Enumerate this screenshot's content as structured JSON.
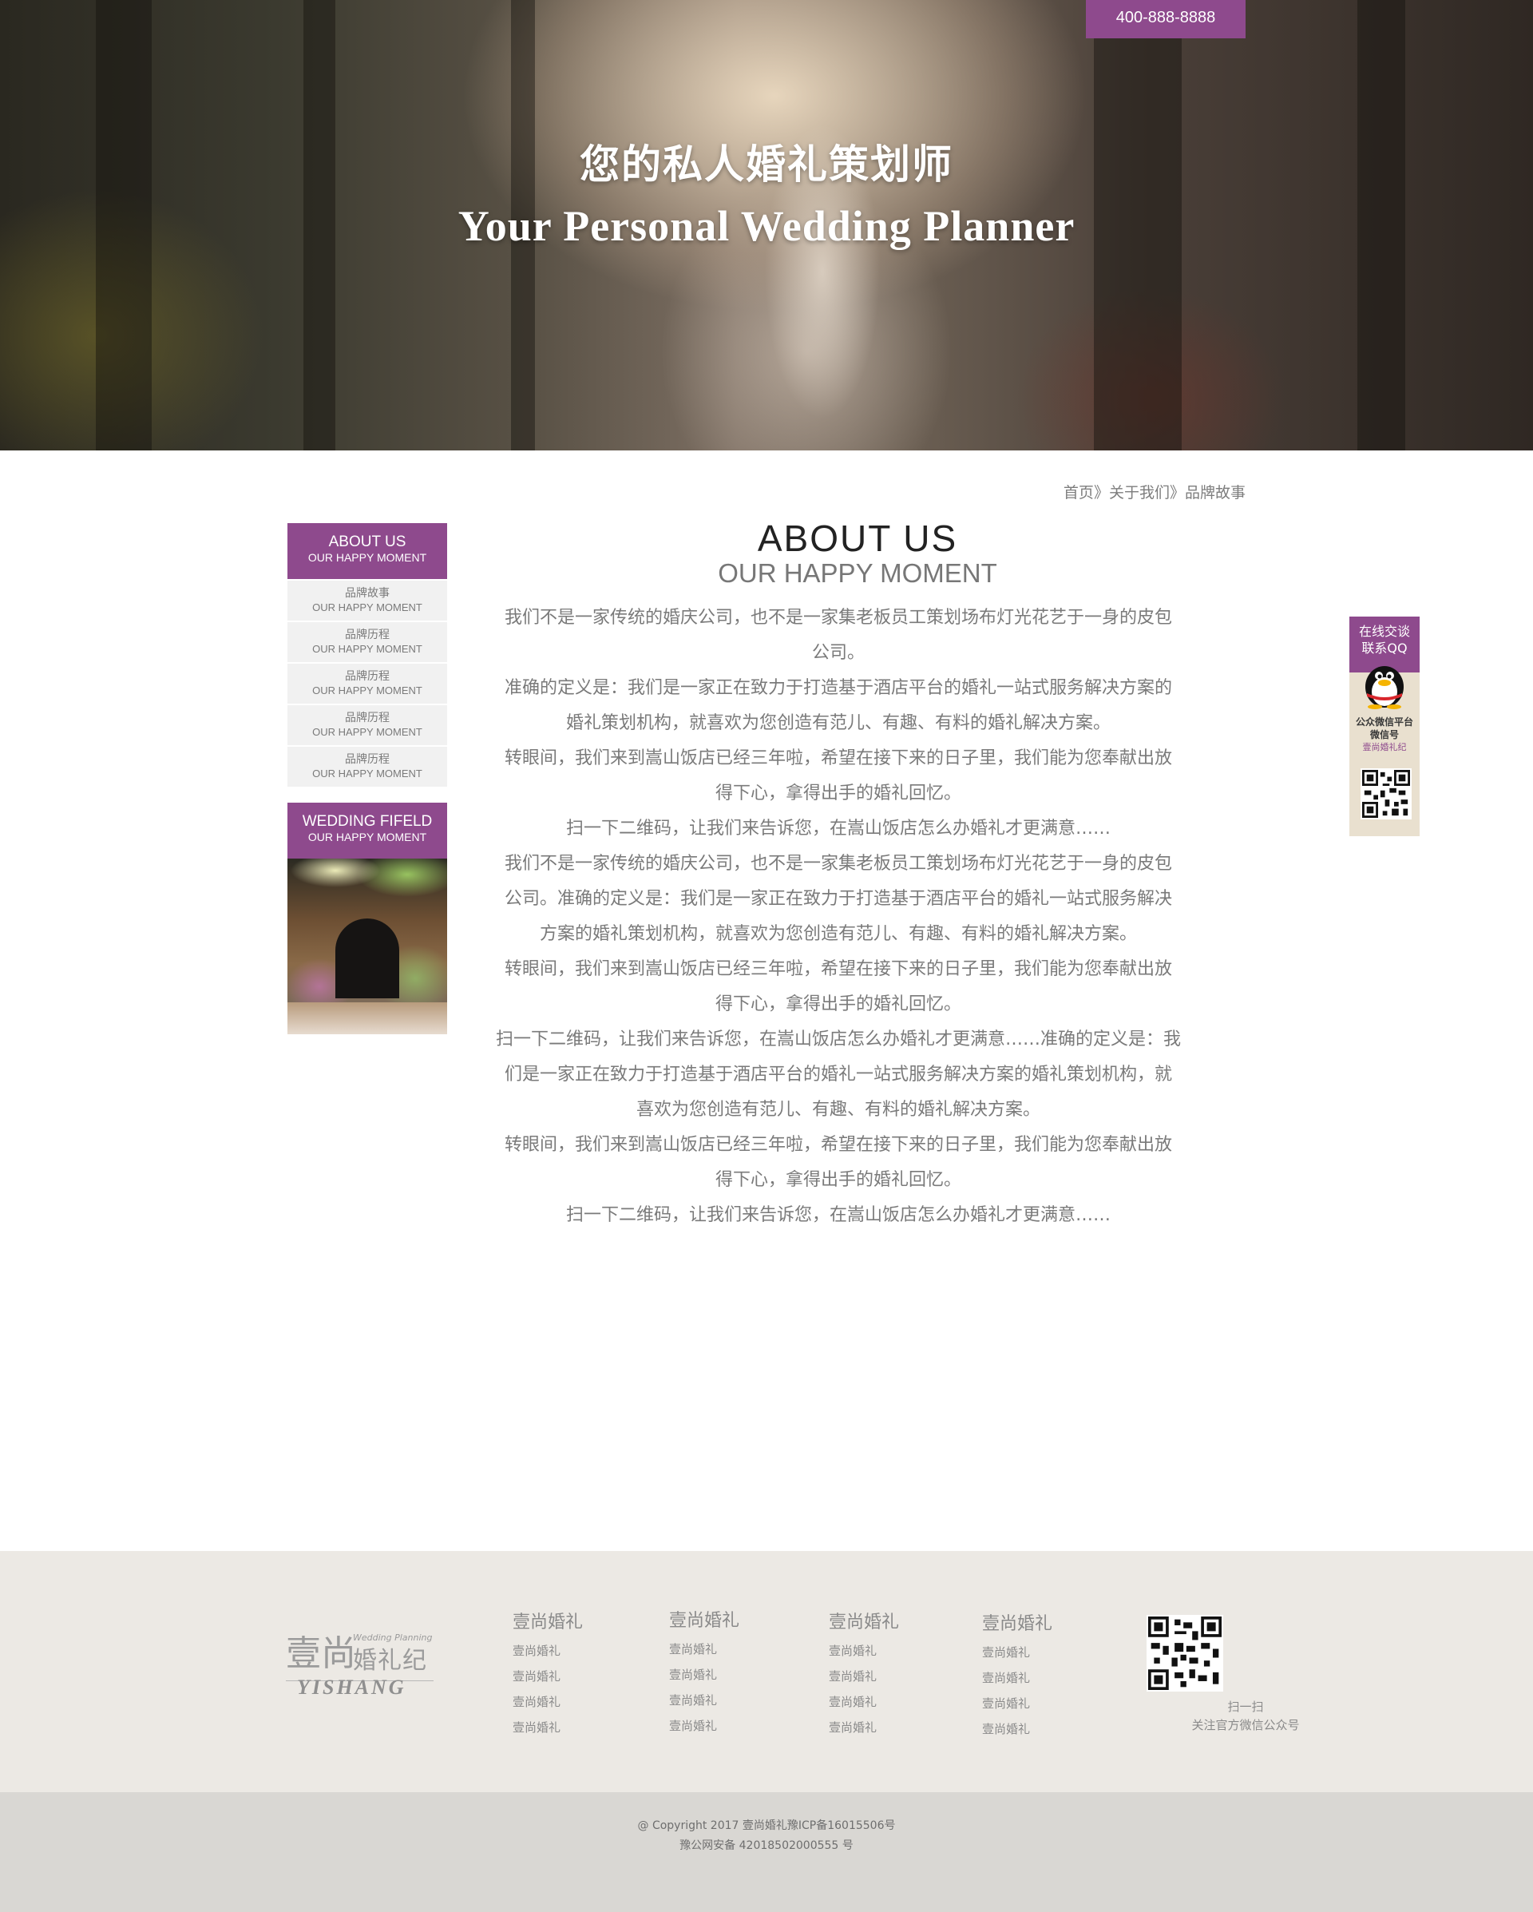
{
  "hero": {
    "phone": "400-888-8888",
    "title_cn": "您的私人婚礼策划师",
    "title_en": "Your Personal Wedding Planner"
  },
  "breadcrumb": {
    "home": "首页",
    "sep1": "》",
    "about": "关于我们",
    "sep2": "》",
    "current": "品牌故事"
  },
  "sidebar": {
    "header": {
      "title": "ABOUT US",
      "subtitle": "OUR HAPPY MOMENT"
    },
    "items": [
      {
        "cn": "品牌故事",
        "en": "OUR HAPPY MOMENT"
      },
      {
        "cn": "品牌历程",
        "en": "OUR HAPPY MOMENT"
      },
      {
        "cn": "品牌历程",
        "en": "OUR HAPPY MOMENT"
      },
      {
        "cn": "品牌历程",
        "en": "OUR HAPPY MOMENT"
      },
      {
        "cn": "品牌历程",
        "en": "OUR HAPPY MOMENT"
      }
    ],
    "header2": {
      "title": "WEDDING FIFELD",
      "subtitle": "OUR HAPPY MOMENT"
    }
  },
  "main": {
    "title": "ABOUT  US",
    "subtitle": "OUR HAPPY MOMENT",
    "paragraphs": [
      "我们不是一家传统的婚庆公司，也不是一家集老板员工策划场布灯光花艺于一身的皮包",
      "公司。",
      "准确的定义是：我们是一家正在致力于打造基于酒店平台的婚礼一站式服务解决方案的",
      "婚礼策划机构，就喜欢为您创造有范儿、有趣、有料的婚礼解决方案。",
      "转眼间，我们来到嵩山饭店已经三年啦，希望在接下来的日子里，我们能为您奉献出放",
      "得下心，拿得出手的婚礼回忆。",
      "扫一下二维码，让我们来告诉您，在嵩山饭店怎么办婚礼才更满意……",
      "我们不是一家传统的婚庆公司，也不是一家集老板员工策划场布灯光花艺于一身的皮包",
      "公司。准确的定义是：我们是一家正在致力于打造基于酒店平台的婚礼一站式服务解决",
      "方案的婚礼策划机构，就喜欢为您创造有范儿、有趣、有料的婚礼解决方案。",
      "转眼间，我们来到嵩山饭店已经三年啦，希望在接下来的日子里，我们能为您奉献出放",
      "得下心，拿得出手的婚礼回忆。",
      "扫一下二维码，让我们来告诉您，在嵩山饭店怎么办婚礼才更满意……准确的定义是：我",
      "们是一家正在致力于打造基于酒店平台的婚礼一站式服务解决方案的婚礼策划机构，就",
      "喜欢为您创造有范儿、有趣、有料的婚礼解决方案。",
      "转眼间，我们来到嵩山饭店已经三年啦，希望在接下来的日子里，我们能为您奉献出放",
      "得下心，拿得出手的婚礼回忆。",
      "扫一下二维码，让我们来告诉您，在嵩山饭店怎么办婚礼才更满意……"
    ]
  },
  "float_widget": {
    "line1": "在线交谈",
    "line2": "联系QQ",
    "wechat_line1": "公众微信平台",
    "wechat_line2": "微信号",
    "wechat_id": "壹尚婚礼纪",
    "icon": "qq-penguin-icon"
  },
  "footer": {
    "logo": {
      "main": "壹尚",
      "side": "婚礼纪",
      "small": "Wedding Planning",
      "en": "YISHANG"
    },
    "columns": [
      {
        "head": "壹尚婚礼",
        "links": [
          "壹尚婚礼",
          "壹尚婚礼",
          "壹尚婚礼",
          "壹尚婚礼"
        ]
      },
      {
        "head": "壹尚婚礼",
        "links": [
          "壹尚婚礼",
          "壹尚婚礼",
          "壹尚婚礼",
          "壹尚婚礼"
        ]
      },
      {
        "head": "壹尚婚礼",
        "links": [
          "壹尚婚礼",
          "壹尚婚礼",
          "壹尚婚礼",
          "壹尚婚礼"
        ]
      },
      {
        "head": "壹尚婚礼",
        "links": [
          "壹尚婚礼",
          "壹尚婚礼",
          "壹尚婚礼",
          "壹尚婚礼"
        ]
      }
    ],
    "qr_line1": "扫一扫",
    "qr_line2": "关注官方微信公众号",
    "copyright1": "@ Copyright 2017 壹尚婚礼豫ICP备16015506号",
    "copyright2": "豫公网安备 42018502000555 号"
  },
  "colors": {
    "accent": "#8e4a8d",
    "footer_bg": "#ece9e4",
    "copyright_bg": "#d9d7d3"
  }
}
